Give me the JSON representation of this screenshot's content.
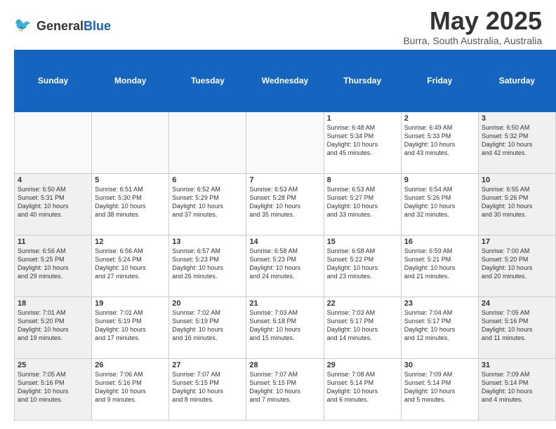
{
  "header": {
    "logo_general": "General",
    "logo_blue": "Blue",
    "title": "May 2025",
    "location": "Burra, South Australia, Australia"
  },
  "days_of_week": [
    "Sunday",
    "Monday",
    "Tuesday",
    "Wednesday",
    "Thursday",
    "Friday",
    "Saturday"
  ],
  "weeks": [
    [
      {
        "num": "",
        "info": "",
        "empty": true
      },
      {
        "num": "",
        "info": "",
        "empty": true
      },
      {
        "num": "",
        "info": "",
        "empty": true
      },
      {
        "num": "",
        "info": "",
        "empty": true
      },
      {
        "num": "1",
        "info": "Sunrise: 6:48 AM\nSunset: 5:34 PM\nDaylight: 10 hours\nand 45 minutes.",
        "empty": false
      },
      {
        "num": "2",
        "info": "Sunrise: 6:49 AM\nSunset: 5:33 PM\nDaylight: 10 hours\nand 43 minutes.",
        "empty": false
      },
      {
        "num": "3",
        "info": "Sunrise: 6:50 AM\nSunset: 5:32 PM\nDaylight: 10 hours\nand 42 minutes.",
        "empty": false
      }
    ],
    [
      {
        "num": "4",
        "info": "Sunrise: 6:50 AM\nSunset: 5:31 PM\nDaylight: 10 hours\nand 40 minutes.",
        "empty": false
      },
      {
        "num": "5",
        "info": "Sunrise: 6:51 AM\nSunset: 5:30 PM\nDaylight: 10 hours\nand 38 minutes.",
        "empty": false
      },
      {
        "num": "6",
        "info": "Sunrise: 6:52 AM\nSunset: 5:29 PM\nDaylight: 10 hours\nand 37 minutes.",
        "empty": false
      },
      {
        "num": "7",
        "info": "Sunrise: 6:53 AM\nSunset: 5:28 PM\nDaylight: 10 hours\nand 35 minutes.",
        "empty": false
      },
      {
        "num": "8",
        "info": "Sunrise: 6:53 AM\nSunset: 5:27 PM\nDaylight: 10 hours\nand 33 minutes.",
        "empty": false
      },
      {
        "num": "9",
        "info": "Sunrise: 6:54 AM\nSunset: 5:26 PM\nDaylight: 10 hours\nand 32 minutes.",
        "empty": false
      },
      {
        "num": "10",
        "info": "Sunrise: 6:55 AM\nSunset: 5:26 PM\nDaylight: 10 hours\nand 30 minutes.",
        "empty": false
      }
    ],
    [
      {
        "num": "11",
        "info": "Sunrise: 6:56 AM\nSunset: 5:25 PM\nDaylight: 10 hours\nand 29 minutes.",
        "empty": false
      },
      {
        "num": "12",
        "info": "Sunrise: 6:56 AM\nSunset: 5:24 PM\nDaylight: 10 hours\nand 27 minutes.",
        "empty": false
      },
      {
        "num": "13",
        "info": "Sunrise: 6:57 AM\nSunset: 5:23 PM\nDaylight: 10 hours\nand 26 minutes.",
        "empty": false
      },
      {
        "num": "14",
        "info": "Sunrise: 6:58 AM\nSunset: 5:23 PM\nDaylight: 10 hours\nand 24 minutes.",
        "empty": false
      },
      {
        "num": "15",
        "info": "Sunrise: 6:58 AM\nSunset: 5:22 PM\nDaylight: 10 hours\nand 23 minutes.",
        "empty": false
      },
      {
        "num": "16",
        "info": "Sunrise: 6:59 AM\nSunset: 5:21 PM\nDaylight: 10 hours\nand 21 minutes.",
        "empty": false
      },
      {
        "num": "17",
        "info": "Sunrise: 7:00 AM\nSunset: 5:20 PM\nDaylight: 10 hours\nand 20 minutes.",
        "empty": false
      }
    ],
    [
      {
        "num": "18",
        "info": "Sunrise: 7:01 AM\nSunset: 5:20 PM\nDaylight: 10 hours\nand 19 minutes.",
        "empty": false
      },
      {
        "num": "19",
        "info": "Sunrise: 7:01 AM\nSunset: 5:19 PM\nDaylight: 10 hours\nand 17 minutes.",
        "empty": false
      },
      {
        "num": "20",
        "info": "Sunrise: 7:02 AM\nSunset: 5:19 PM\nDaylight: 10 hours\nand 16 minutes.",
        "empty": false
      },
      {
        "num": "21",
        "info": "Sunrise: 7:03 AM\nSunset: 5:18 PM\nDaylight: 10 hours\nand 15 minutes.",
        "empty": false
      },
      {
        "num": "22",
        "info": "Sunrise: 7:03 AM\nSunset: 5:17 PM\nDaylight: 10 hours\nand 14 minutes.",
        "empty": false
      },
      {
        "num": "23",
        "info": "Sunrise: 7:04 AM\nSunset: 5:17 PM\nDaylight: 10 hours\nand 12 minutes.",
        "empty": false
      },
      {
        "num": "24",
        "info": "Sunrise: 7:05 AM\nSunset: 5:16 PM\nDaylight: 10 hours\nand 11 minutes.",
        "empty": false
      }
    ],
    [
      {
        "num": "25",
        "info": "Sunrise: 7:05 AM\nSunset: 5:16 PM\nDaylight: 10 hours\nand 10 minutes.",
        "empty": false
      },
      {
        "num": "26",
        "info": "Sunrise: 7:06 AM\nSunset: 5:16 PM\nDaylight: 10 hours\nand 9 minutes.",
        "empty": false
      },
      {
        "num": "27",
        "info": "Sunrise: 7:07 AM\nSunset: 5:15 PM\nDaylight: 10 hours\nand 8 minutes.",
        "empty": false
      },
      {
        "num": "28",
        "info": "Sunrise: 7:07 AM\nSunset: 5:15 PM\nDaylight: 10 hours\nand 7 minutes.",
        "empty": false
      },
      {
        "num": "29",
        "info": "Sunrise: 7:08 AM\nSunset: 5:14 PM\nDaylight: 10 hours\nand 6 minutes.",
        "empty": false
      },
      {
        "num": "30",
        "info": "Sunrise: 7:09 AM\nSunset: 5:14 PM\nDaylight: 10 hours\nand 5 minutes.",
        "empty": false
      },
      {
        "num": "31",
        "info": "Sunrise: 7:09 AM\nSunset: 5:14 PM\nDaylight: 10 hours\nand 4 minutes.",
        "empty": false
      }
    ]
  ]
}
